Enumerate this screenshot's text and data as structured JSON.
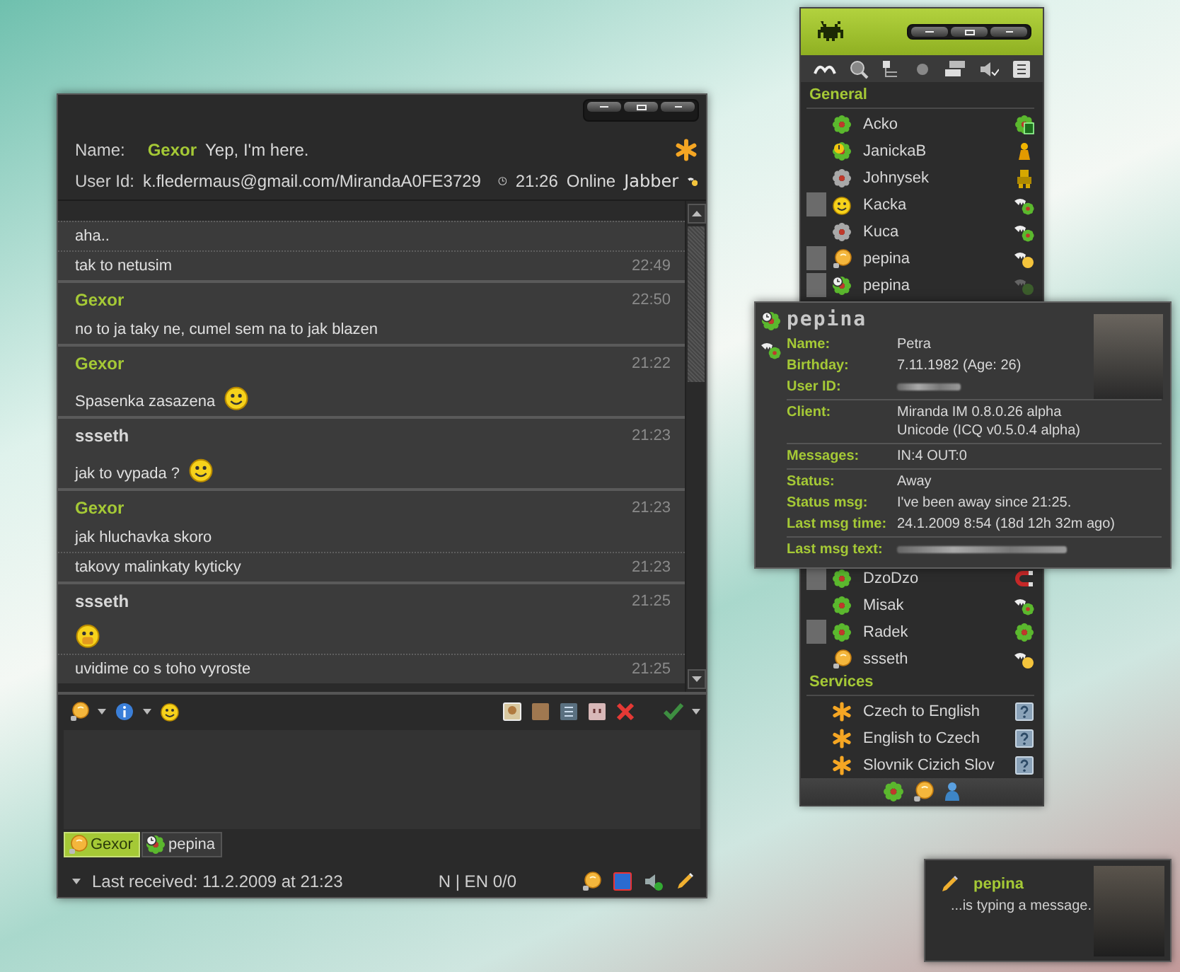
{
  "chat": {
    "header": {
      "name_label": "Name:",
      "name": "Gexor",
      "status_message": "Yep, I'm here.",
      "user_id_label": "User Id:",
      "user_id": "k.fledermaus@gmail.com/MirandaA0FE3729",
      "time": "21:26",
      "status": "Online",
      "protocol": "Jabber"
    },
    "messages": [
      {
        "kind": "continuation",
        "text": "aha.."
      },
      {
        "kind": "continuation",
        "text": "tak to netusim",
        "time": "22:49"
      },
      {
        "kind": "header",
        "sender": "Gexor",
        "color": "#a5c936",
        "time": "22:50",
        "text": "no to ja taky ne, cumel sem na to jak blazen"
      },
      {
        "kind": "header",
        "sender": "Gexor",
        "color": "#a5c936",
        "time": "21:22",
        "text": "Spasenka zasazena",
        "emoticon": {
          "kind": "smile"
        }
      },
      {
        "kind": "header",
        "sender": "ssseth",
        "color": "#d8d8d8",
        "time": "21:23",
        "text": "jak to vypada ?",
        "emoticon": {
          "kind": "smile"
        }
      },
      {
        "kind": "header",
        "sender": "Gexor",
        "color": "#a5c936",
        "time": "21:23",
        "text": "jak hluchavka skoro"
      },
      {
        "kind": "continuation",
        "text": "takovy malinkaty kyticky",
        "time": "21:23"
      },
      {
        "kind": "header",
        "sender": "ssseth",
        "color": "#d8d8d8",
        "time": "21:25",
        "emoticon": {
          "kind": "laugh"
        }
      },
      {
        "kind": "continuation",
        "text": "uvidime co s toho vyroste",
        "time": "21:25"
      }
    ],
    "tabs": [
      {
        "label": "Gexor",
        "selected": true,
        "status_icon": {
          "kind": "away-jabber"
        }
      },
      {
        "label": "pepina",
        "selected": false,
        "status_icon": {
          "kind": "away-icq"
        }
      }
    ],
    "status_bar": {
      "last_received": "Last received: 11.2.2009 at 21:23",
      "input_mode": "N | EN 0/0"
    }
  },
  "contact_list": {
    "groups": [
      {
        "name": "General",
        "contacts": [
          {
            "name": "Acko",
            "status_icon": {
              "kind": "online"
            },
            "avatar": false,
            "client_icon": {
              "kind": "icq6"
            }
          },
          {
            "name": "JanickaB",
            "status_icon": {
              "kind": "occupied"
            },
            "avatar": false,
            "client_icon": {
              "kind": "person"
            }
          },
          {
            "name": "Johnysek",
            "status_icon": {
              "kind": "offline"
            },
            "avatar": false,
            "client_icon": {
              "kind": "robot"
            }
          },
          {
            "name": "Kacka",
            "status_icon": {
              "kind": "party"
            },
            "avatar": true,
            "client_icon": {
              "kind": "miranda"
            }
          },
          {
            "name": "Kuca",
            "status_icon": {
              "kind": "offline"
            },
            "avatar": false,
            "client_icon": {
              "kind": "miranda"
            }
          },
          {
            "name": "pepina",
            "status_icon": {
              "kind": "bulb"
            },
            "avatar": true,
            "client_icon": {
              "kind": "mirandabulb"
            }
          },
          {
            "name": "pepina",
            "status_icon": {
              "kind": "away"
            },
            "avatar": true,
            "client_icon": {
              "kind": "faded"
            }
          }
        ]
      },
      {
        "contacts": [
          {
            "name": "DzoDzo",
            "status_icon": {
              "kind": "online"
            },
            "avatar": true,
            "client_icon": {
              "kind": "magnet"
            }
          },
          {
            "name": "Misak",
            "status_icon": {
              "kind": "online"
            },
            "avatar": false,
            "client_icon": {
              "kind": "miranda"
            }
          },
          {
            "name": "Radek",
            "status_icon": {
              "kind": "online"
            },
            "avatar": true,
            "client_icon": {
              "kind": "icq"
            }
          },
          {
            "name": "ssseth",
            "status_icon": {
              "kind": "bulb"
            },
            "avatar": false,
            "client_icon": {
              "kind": "mirandabulb"
            }
          }
        ]
      },
      {
        "name": "Services",
        "contacts": [
          {
            "name": "Czech to English",
            "status_icon": {
              "kind": "service"
            },
            "avatar": false,
            "client_icon": {
              "kind": "help"
            }
          },
          {
            "name": "English to Czech",
            "status_icon": {
              "kind": "service"
            },
            "avatar": false,
            "client_icon": {
              "kind": "help"
            }
          },
          {
            "name": "Slovnik Cizich Slov",
            "status_icon": {
              "kind": "service"
            },
            "avatar": false,
            "client_icon": {
              "kind": "help"
            }
          }
        ]
      }
    ]
  },
  "tooltip": {
    "title": "pepina",
    "sections": [
      [
        {
          "label": "Name:",
          "kind": "text",
          "lines": [
            "Petra"
          ]
        },
        {
          "label": "Birthday:",
          "kind": "text",
          "lines": [
            "7.11.1982 (Age: 26)"
          ]
        },
        {
          "label": "User ID:",
          "kind": "redacted"
        }
      ],
      [
        {
          "label": "Client:",
          "kind": "text",
          "lines": [
            "Miranda IM 0.8.0.26 alpha",
            "Unicode (ICQ v0.5.0.4 alpha)"
          ]
        }
      ],
      [
        {
          "label": "Messages:",
          "kind": "text",
          "lines": [
            "IN:4 OUT:0"
          ]
        }
      ],
      [
        {
          "label": "Status:",
          "kind": "text",
          "lines": [
            "Away"
          ]
        },
        {
          "label": "Status msg:",
          "kind": "text",
          "lines": [
            "I've been away since 21:25."
          ]
        },
        {
          "label": "Last msg time:",
          "kind": "text",
          "lines": [
            "24.1.2009 8:54 (18d 12h 32m ago)"
          ]
        }
      ],
      [
        {
          "label": "Last msg text:",
          "kind": "redacted"
        }
      ]
    ]
  },
  "typing_popup": {
    "name": "pepina",
    "text": "...is typing a message."
  }
}
